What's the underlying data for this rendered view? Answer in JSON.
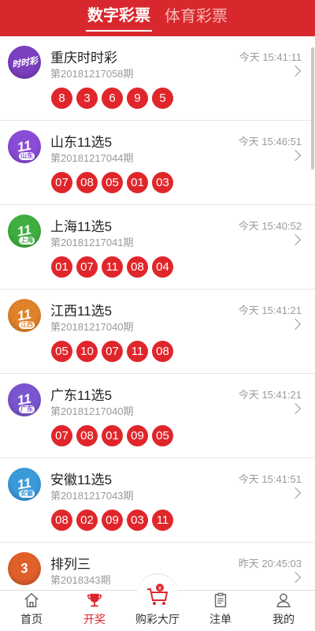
{
  "header": {
    "tabs": [
      "数字彩票",
      "体育彩票"
    ],
    "active": 0
  },
  "lotteries": [
    {
      "name": "重庆时时彩",
      "issue": "第20181217058期",
      "time": "今天 15:41:11",
      "balls": [
        "8",
        "3",
        "6",
        "9",
        "5"
      ],
      "logo_text": "时时彩",
      "logo_color": "#7b3fbf"
    },
    {
      "name": "山东11选5",
      "issue": "第20181217044期",
      "time": "今天 15:46:51",
      "balls": [
        "07",
        "08",
        "05",
        "01",
        "03"
      ],
      "logo_text": "11",
      "logo_sub": "山东",
      "logo_color": "#8a4bd6"
    },
    {
      "name": "上海11选5",
      "issue": "第20181217041期",
      "time": "今天 15:40:52",
      "balls": [
        "01",
        "07",
        "11",
        "08",
        "04"
      ],
      "logo_text": "11",
      "logo_sub": "上海",
      "logo_color": "#3fae3f"
    },
    {
      "name": "江西11选5",
      "issue": "第20181217040期",
      "time": "今天 15:41:21",
      "balls": [
        "05",
        "10",
        "07",
        "11",
        "08"
      ],
      "logo_text": "11",
      "logo_sub": "江西",
      "logo_color": "#e0822a"
    },
    {
      "name": "广东11选5",
      "issue": "第20181217040期",
      "time": "今天 15:41:21",
      "balls": [
        "07",
        "08",
        "01",
        "09",
        "05"
      ],
      "logo_text": "11",
      "logo_sub": "广东",
      "logo_color": "#7a55d0"
    },
    {
      "name": "安徽11选5",
      "issue": "第20181217043期",
      "time": "今天 15:41:51",
      "balls": [
        "08",
        "02",
        "09",
        "03",
        "11"
      ],
      "logo_text": "11",
      "logo_sub": "安徽",
      "logo_color": "#3a9ad9"
    },
    {
      "name": "排列三",
      "issue": "第2018343期",
      "time": "昨天 20:45:03",
      "balls": [],
      "logo_text": "3",
      "logo_color": "#e0602a"
    }
  ],
  "tabbar": [
    {
      "label": "首页",
      "icon": "home-icon"
    },
    {
      "label": "开奖",
      "icon": "trophy-icon",
      "active": true
    },
    {
      "label": "购彩大厅",
      "icon": "cart-icon"
    },
    {
      "label": "注单",
      "icon": "clipboard-icon"
    },
    {
      "label": "我的",
      "icon": "user-icon"
    }
  ],
  "colors": {
    "brand": "#d9282d",
    "ball": "#e0262b"
  }
}
